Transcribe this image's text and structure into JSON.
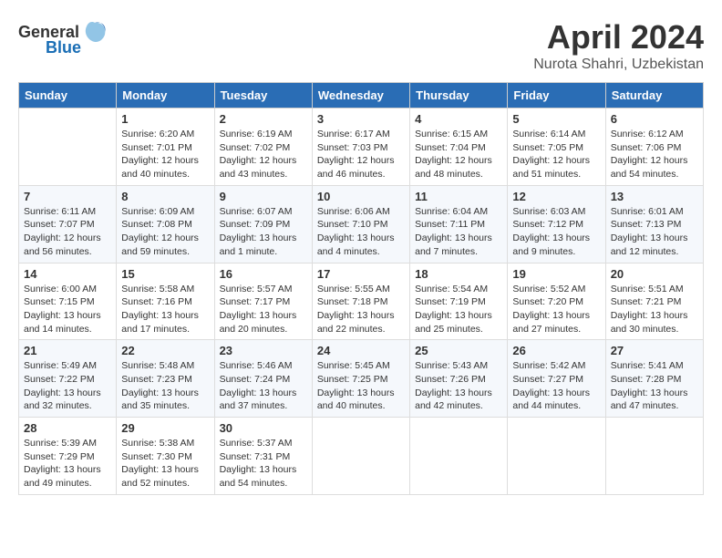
{
  "header": {
    "logo_general": "General",
    "logo_blue": "Blue",
    "month_year": "April 2024",
    "location": "Nurota Shahri, Uzbekistan"
  },
  "weekdays": [
    "Sunday",
    "Monday",
    "Tuesday",
    "Wednesday",
    "Thursday",
    "Friday",
    "Saturday"
  ],
  "weeks": [
    [
      {
        "day": "",
        "info": ""
      },
      {
        "day": "1",
        "info": "Sunrise: 6:20 AM\nSunset: 7:01 PM\nDaylight: 12 hours\nand 40 minutes."
      },
      {
        "day": "2",
        "info": "Sunrise: 6:19 AM\nSunset: 7:02 PM\nDaylight: 12 hours\nand 43 minutes."
      },
      {
        "day": "3",
        "info": "Sunrise: 6:17 AM\nSunset: 7:03 PM\nDaylight: 12 hours\nand 46 minutes."
      },
      {
        "day": "4",
        "info": "Sunrise: 6:15 AM\nSunset: 7:04 PM\nDaylight: 12 hours\nand 48 minutes."
      },
      {
        "day": "5",
        "info": "Sunrise: 6:14 AM\nSunset: 7:05 PM\nDaylight: 12 hours\nand 51 minutes."
      },
      {
        "day": "6",
        "info": "Sunrise: 6:12 AM\nSunset: 7:06 PM\nDaylight: 12 hours\nand 54 minutes."
      }
    ],
    [
      {
        "day": "7",
        "info": "Sunrise: 6:11 AM\nSunset: 7:07 PM\nDaylight: 12 hours\nand 56 minutes."
      },
      {
        "day": "8",
        "info": "Sunrise: 6:09 AM\nSunset: 7:08 PM\nDaylight: 12 hours\nand 59 minutes."
      },
      {
        "day": "9",
        "info": "Sunrise: 6:07 AM\nSunset: 7:09 PM\nDaylight: 13 hours\nand 1 minute."
      },
      {
        "day": "10",
        "info": "Sunrise: 6:06 AM\nSunset: 7:10 PM\nDaylight: 13 hours\nand 4 minutes."
      },
      {
        "day": "11",
        "info": "Sunrise: 6:04 AM\nSunset: 7:11 PM\nDaylight: 13 hours\nand 7 minutes."
      },
      {
        "day": "12",
        "info": "Sunrise: 6:03 AM\nSunset: 7:12 PM\nDaylight: 13 hours\nand 9 minutes."
      },
      {
        "day": "13",
        "info": "Sunrise: 6:01 AM\nSunset: 7:13 PM\nDaylight: 13 hours\nand 12 minutes."
      }
    ],
    [
      {
        "day": "14",
        "info": "Sunrise: 6:00 AM\nSunset: 7:15 PM\nDaylight: 13 hours\nand 14 minutes."
      },
      {
        "day": "15",
        "info": "Sunrise: 5:58 AM\nSunset: 7:16 PM\nDaylight: 13 hours\nand 17 minutes."
      },
      {
        "day": "16",
        "info": "Sunrise: 5:57 AM\nSunset: 7:17 PM\nDaylight: 13 hours\nand 20 minutes."
      },
      {
        "day": "17",
        "info": "Sunrise: 5:55 AM\nSunset: 7:18 PM\nDaylight: 13 hours\nand 22 minutes."
      },
      {
        "day": "18",
        "info": "Sunrise: 5:54 AM\nSunset: 7:19 PM\nDaylight: 13 hours\nand 25 minutes."
      },
      {
        "day": "19",
        "info": "Sunrise: 5:52 AM\nSunset: 7:20 PM\nDaylight: 13 hours\nand 27 minutes."
      },
      {
        "day": "20",
        "info": "Sunrise: 5:51 AM\nSunset: 7:21 PM\nDaylight: 13 hours\nand 30 minutes."
      }
    ],
    [
      {
        "day": "21",
        "info": "Sunrise: 5:49 AM\nSunset: 7:22 PM\nDaylight: 13 hours\nand 32 minutes."
      },
      {
        "day": "22",
        "info": "Sunrise: 5:48 AM\nSunset: 7:23 PM\nDaylight: 13 hours\nand 35 minutes."
      },
      {
        "day": "23",
        "info": "Sunrise: 5:46 AM\nSunset: 7:24 PM\nDaylight: 13 hours\nand 37 minutes."
      },
      {
        "day": "24",
        "info": "Sunrise: 5:45 AM\nSunset: 7:25 PM\nDaylight: 13 hours\nand 40 minutes."
      },
      {
        "day": "25",
        "info": "Sunrise: 5:43 AM\nSunset: 7:26 PM\nDaylight: 13 hours\nand 42 minutes."
      },
      {
        "day": "26",
        "info": "Sunrise: 5:42 AM\nSunset: 7:27 PM\nDaylight: 13 hours\nand 44 minutes."
      },
      {
        "day": "27",
        "info": "Sunrise: 5:41 AM\nSunset: 7:28 PM\nDaylight: 13 hours\nand 47 minutes."
      }
    ],
    [
      {
        "day": "28",
        "info": "Sunrise: 5:39 AM\nSunset: 7:29 PM\nDaylight: 13 hours\nand 49 minutes."
      },
      {
        "day": "29",
        "info": "Sunrise: 5:38 AM\nSunset: 7:30 PM\nDaylight: 13 hours\nand 52 minutes."
      },
      {
        "day": "30",
        "info": "Sunrise: 5:37 AM\nSunset: 7:31 PM\nDaylight: 13 hours\nand 54 minutes."
      },
      {
        "day": "",
        "info": ""
      },
      {
        "day": "",
        "info": ""
      },
      {
        "day": "",
        "info": ""
      },
      {
        "day": "",
        "info": ""
      }
    ]
  ]
}
